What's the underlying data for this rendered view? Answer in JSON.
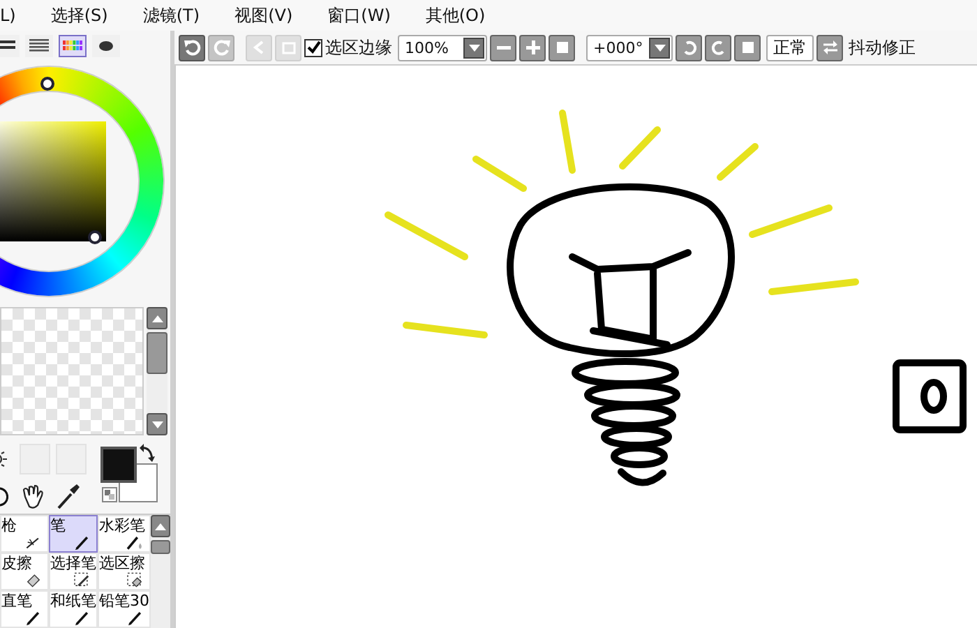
{
  "menu": [
    {
      "label": "L)"
    },
    {
      "label": "选择(S)"
    },
    {
      "label": "滤镜(T)"
    },
    {
      "label": "视图(V)"
    },
    {
      "label": "窗口(W)"
    },
    {
      "label": "其他(O)"
    }
  ],
  "panel_tabs": [
    {
      "kind": "bars",
      "selected": false
    },
    {
      "kind": "list",
      "selected": false
    },
    {
      "kind": "swatches",
      "selected": true
    },
    {
      "kind": "blob",
      "selected": false
    }
  ],
  "toolbar": {
    "selection_edge": {
      "label": "选区边缘",
      "checked": true
    },
    "zoom": "100%",
    "rotation": "+000°",
    "mode_button": "正常",
    "stabilizer_label": "抖动修正"
  },
  "tools": [
    {
      "label": "枪",
      "kind": "airbrush",
      "selected": false
    },
    {
      "label": "笔",
      "kind": "pen",
      "selected": true
    },
    {
      "label": "水彩笔",
      "kind": "watercolor",
      "selected": false
    },
    {
      "label": "皮擦",
      "kind": "eraser",
      "selected": false
    },
    {
      "label": "选择笔",
      "kind": "select-pen",
      "selected": false
    },
    {
      "label": "选区擦",
      "kind": "select-eraser",
      "selected": false
    },
    {
      "label": "直笔",
      "kind": "pen",
      "selected": false
    },
    {
      "label": "和纸笔",
      "kind": "pen",
      "selected": false
    },
    {
      "label": "铅笔30",
      "kind": "pen",
      "selected": false
    }
  ]
}
